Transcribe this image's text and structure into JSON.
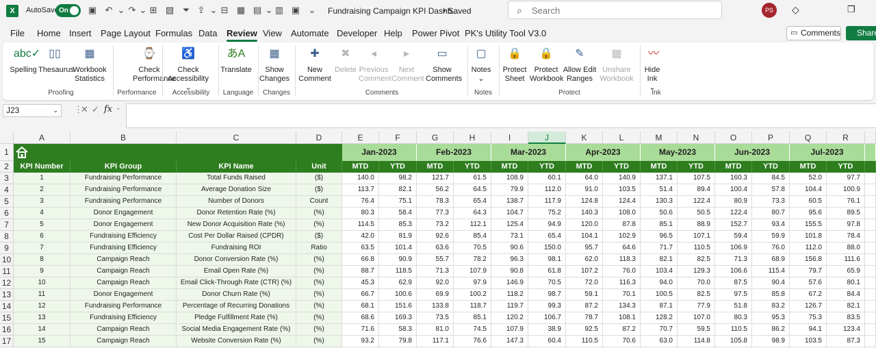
{
  "titlebar": {
    "autosave_label": "AutoSave",
    "autosave_state": "On",
    "doc_title": "Fundraising Campaign KPI Dashb...",
    "saved": "• Saved",
    "search_placeholder": "Search",
    "avatar_initials": "PS"
  },
  "tabs": [
    "File",
    "Home",
    "Insert",
    "Page Layout",
    "Formulas",
    "Data",
    "Review",
    "View",
    "Automate",
    "Developer",
    "Help",
    "Power Pivot",
    "PK's Utility Tool V3.0"
  ],
  "active_tab": "Review",
  "actions": {
    "comments": "Comments",
    "share": "Share"
  },
  "ribbon": {
    "buttons": [
      {
        "label": "Spelling",
        "icon": "spelling-icon"
      },
      {
        "label": "Thesaurus",
        "icon": "thesaurus-icon"
      },
      {
        "label": "Workbook Statistics",
        "icon": "workbook-statistics-icon"
      },
      {
        "label": "Check Performance",
        "icon": "check-performance-icon"
      },
      {
        "label": "Check Accessibility ⌄",
        "icon": "accessibility-icon"
      },
      {
        "label": "Translate",
        "icon": "translate-icon"
      },
      {
        "label": "Show Changes",
        "icon": "show-changes-icon"
      },
      {
        "label": "New Comment",
        "icon": "new-comment-icon"
      },
      {
        "label": "Delete",
        "icon": "delete-comment-icon"
      },
      {
        "label": "Previous Comment",
        "icon": "previous-comment-icon"
      },
      {
        "label": "Next Comment",
        "icon": "next-comment-icon"
      },
      {
        "label": "Show Comments",
        "icon": "show-comments-icon"
      },
      {
        "label": "Notes ⌄",
        "icon": "notes-icon"
      },
      {
        "label": "Protect Sheet",
        "icon": "protect-sheet-icon"
      },
      {
        "label": "Protect Workbook",
        "icon": "protect-workbook-icon"
      },
      {
        "label": "Allow Edit Ranges",
        "icon": "allow-edit-ranges-icon"
      },
      {
        "label": "Unshare Workbook",
        "icon": "unshare-workbook-icon"
      },
      {
        "label": "Hide Ink ⌄",
        "icon": "hide-ink-icon"
      }
    ],
    "groups": [
      "Proofing",
      "Performance",
      "Accessibility",
      "Language",
      "Changes",
      "Comments",
      "Notes",
      "Protect",
      "Ink"
    ]
  },
  "formula_bar": {
    "name_box": "J23",
    "fx": "fx",
    "content": ""
  },
  "columns": [
    "A",
    "B",
    "C",
    "D",
    "E",
    "F",
    "G",
    "H",
    "I",
    "J",
    "K",
    "L",
    "M",
    "N",
    "O",
    "P",
    "Q",
    "R"
  ],
  "selected_column": "J",
  "row_numbers": [
    "1",
    "2",
    "3",
    "4",
    "5",
    "6",
    "7",
    "8",
    "9",
    "10",
    "11",
    "12",
    "13",
    "14",
    "15",
    "16",
    "17"
  ],
  "table": {
    "headers": [
      "KPI Number",
      "KPI Group",
      "KPI Name",
      "Unit"
    ],
    "months": [
      "Jan-2023",
      "Feb-2023",
      "Mar-2023",
      "Apr-2023",
      "May-2023",
      "Jun-2023",
      "Jul-2023"
    ],
    "mtd_label": "MTD",
    "ytd_label": "YTD",
    "rows": [
      [
        "1",
        "Fundraising Performance",
        "Total Funds Raised",
        "($)",
        "140.0",
        "98.2",
        "121.7",
        "61.5",
        "108.9",
        "60.1",
        "64.0",
        "140.9",
        "137.1",
        "107.5",
        "160.3",
        "84.5",
        "52.0",
        "97.7"
      ],
      [
        "2",
        "Fundraising Performance",
        "Average Donation Size",
        "($)",
        "113.7",
        "82.1",
        "56.2",
        "64.5",
        "79.9",
        "112.0",
        "91.0",
        "103.5",
        "51.4",
        "89.4",
        "100.4",
        "57.8",
        "104.4",
        "100.9"
      ],
      [
        "3",
        "Fundraising Performance",
        "Number of Donors",
        "Count",
        "76.4",
        "75.1",
        "78.3",
        "65.4",
        "138.7",
        "117.9",
        "124.8",
        "124.4",
        "130.3",
        "122.4",
        "80.9",
        "73.3",
        "60.5",
        "76.1"
      ],
      [
        "4",
        "Donor Engagement",
        "Donor Retention Rate (%)",
        "(%)",
        "80.3",
        "58.4",
        "77.3",
        "64.3",
        "104.7",
        "75.2",
        "140.3",
        "108.0",
        "50.6",
        "50.5",
        "122.4",
        "80.7",
        "95.6",
        "89.5"
      ],
      [
        "5",
        "Donor Engagement",
        "New Donor Acquisition Rate (%)",
        "(%)",
        "114.5",
        "85.3",
        "73.2",
        "112.1",
        "125.4",
        "94.9",
        "120.0",
        "87.8",
        "85.1",
        "88.9",
        "152.7",
        "93.4",
        "155.5",
        "97.8"
      ],
      [
        "6",
        "Fundraising Efficiency",
        "Cost Per Dollar Raised (CPDR)",
        "($)",
        "42.0",
        "81.9",
        "92.6",
        "85.4",
        "73.1",
        "65.4",
        "104.1",
        "102.9",
        "96.5",
        "107.1",
        "59.4",
        "59.9",
        "101.8",
        "78.4"
      ],
      [
        "7",
        "Fundraising Efficiency",
        "Fundraising ROI",
        "Ratio",
        "63.5",
        "101.4",
        "63.6",
        "70.5",
        "90.6",
        "150.0",
        "95.7",
        "64.6",
        "71.7",
        "110.5",
        "106.9",
        "76.0",
        "112.0",
        "88.0"
      ],
      [
        "8",
        "Campaign Reach",
        "Donor Conversion Rate (%)",
        "(%)",
        "66.8",
        "90.9",
        "55.7",
        "78.2",
        "96.3",
        "98.1",
        "62.0",
        "118.3",
        "82.1",
        "82.5",
        "71.3",
        "68.9",
        "156.8",
        "111.6"
      ],
      [
        "9",
        "Campaign Reach",
        "Email Open Rate (%)",
        "(%)",
        "88.7",
        "118.5",
        "71.3",
        "107.9",
        "90.8",
        "61.8",
        "107.2",
        "76.0",
        "103.4",
        "129.3",
        "106.6",
        "115.4",
        "79.7",
        "65.9"
      ],
      [
        "10",
        "Campaign Reach",
        "Email Click-Through Rate (CTR) (%)",
        "(%)",
        "45.3",
        "62.9",
        "92.0",
        "97.9",
        "146.9",
        "70.5",
        "72.0",
        "116.3",
        "94.0",
        "70.0",
        "87.5",
        "90.4",
        "57.6",
        "80.1"
      ],
      [
        "11",
        "Donor Engagement",
        "Donor Churn Rate (%)",
        "(%)",
        "66.7",
        "100.6",
        "69.9",
        "100.2",
        "118.2",
        "98.7",
        "59.1",
        "70.1",
        "100.5",
        "82.5",
        "97.5",
        "85.8",
        "67.2",
        "84.4"
      ],
      [
        "12",
        "Fundraising Performance",
        "Percentage of Recurring Donations",
        "(%)",
        "68.1",
        "151.6",
        "133.8",
        "118.7",
        "119.7",
        "99.3",
        "87.2",
        "134.3",
        "87.1",
        "77.9",
        "51.8",
        "83.2",
        "126.7",
        "82.1"
      ],
      [
        "13",
        "Fundraising Efficiency",
        "Pledge Fulfillment Rate (%)",
        "(%)",
        "68.6",
        "169.3",
        "73.5",
        "85.1",
        "120.2",
        "106.7",
        "78.7",
        "108.1",
        "128.2",
        "107.0",
        "80.3",
        "95.3",
        "75.3",
        "83.5"
      ],
      [
        "14",
        "Campaign Reach",
        "Social Media Engagement Rate (%)",
        "(%)",
        "71.6",
        "58.3",
        "81.0",
        "74.5",
        "107.9",
        "38.9",
        "92.5",
        "87.2",
        "70.7",
        "59.5",
        "110.5",
        "86.2",
        "94.1",
        "123.4"
      ],
      [
        "15",
        "Campaign Reach",
        "Website Conversion Rate (%)",
        "(%)",
        "93.2",
        "79.8",
        "117.1",
        "76.6",
        "147.3",
        "60.4",
        "110.5",
        "70.6",
        "63.0",
        "114.8",
        "105.8",
        "98.9",
        "103.5",
        "87.3"
      ]
    ]
  },
  "colors": {
    "accent": "#107c41",
    "band_dark": "#2e7d1f",
    "band_light": "#a9dc98",
    "row_tint": "#eef7ea"
  }
}
